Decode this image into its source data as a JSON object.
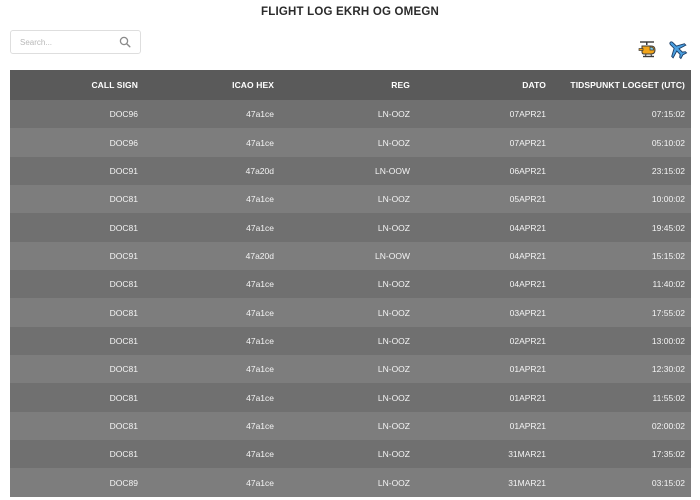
{
  "page": {
    "title": "FLIGHT LOG EKRH OG OMEGN"
  },
  "search": {
    "placeholder": "Search..."
  },
  "toolbar": {
    "helicopter_icon": "helicopter-icon",
    "airplane_icon": "airplane-icon"
  },
  "table": {
    "headers": [
      "CALL SIGN",
      "ICAO HEX",
      "REG",
      "DATO",
      "TIDSPUNKT LOGGET (UTC)"
    ],
    "rows": [
      [
        "DOC96",
        "47a1ce",
        "LN-OOZ",
        "07APR21",
        "07:15:02"
      ],
      [
        "DOC96",
        "47a1ce",
        "LN-OOZ",
        "07APR21",
        "05:10:02"
      ],
      [
        "DOC91",
        "47a20d",
        "LN-OOW",
        "06APR21",
        "23:15:02"
      ],
      [
        "DOC81",
        "47a1ce",
        "LN-OOZ",
        "05APR21",
        "10:00:02"
      ],
      [
        "DOC81",
        "47a1ce",
        "LN-OOZ",
        "04APR21",
        "19:45:02"
      ],
      [
        "DOC91",
        "47a20d",
        "LN-OOW",
        "04APR21",
        "15:15:02"
      ],
      [
        "DOC81",
        "47a1ce",
        "LN-OOZ",
        "04APR21",
        "11:40:02"
      ],
      [
        "DOC81",
        "47a1ce",
        "LN-OOZ",
        "03APR21",
        "17:55:02"
      ],
      [
        "DOC81",
        "47a1ce",
        "LN-OOZ",
        "02APR21",
        "13:00:02"
      ],
      [
        "DOC81",
        "47a1ce",
        "LN-OOZ",
        "01APR21",
        "12:30:02"
      ],
      [
        "DOC81",
        "47a1ce",
        "LN-OOZ",
        "01APR21",
        "11:55:02"
      ],
      [
        "DOC81",
        "47a1ce",
        "LN-OOZ",
        "01APR21",
        "02:00:02"
      ],
      [
        "DOC81",
        "47a1ce",
        "LN-OOZ",
        "31MAR21",
        "17:35:02"
      ],
      [
        "DOC89",
        "47a1ce",
        "LN-OOZ",
        "31MAR21",
        "03:15:02"
      ]
    ]
  }
}
